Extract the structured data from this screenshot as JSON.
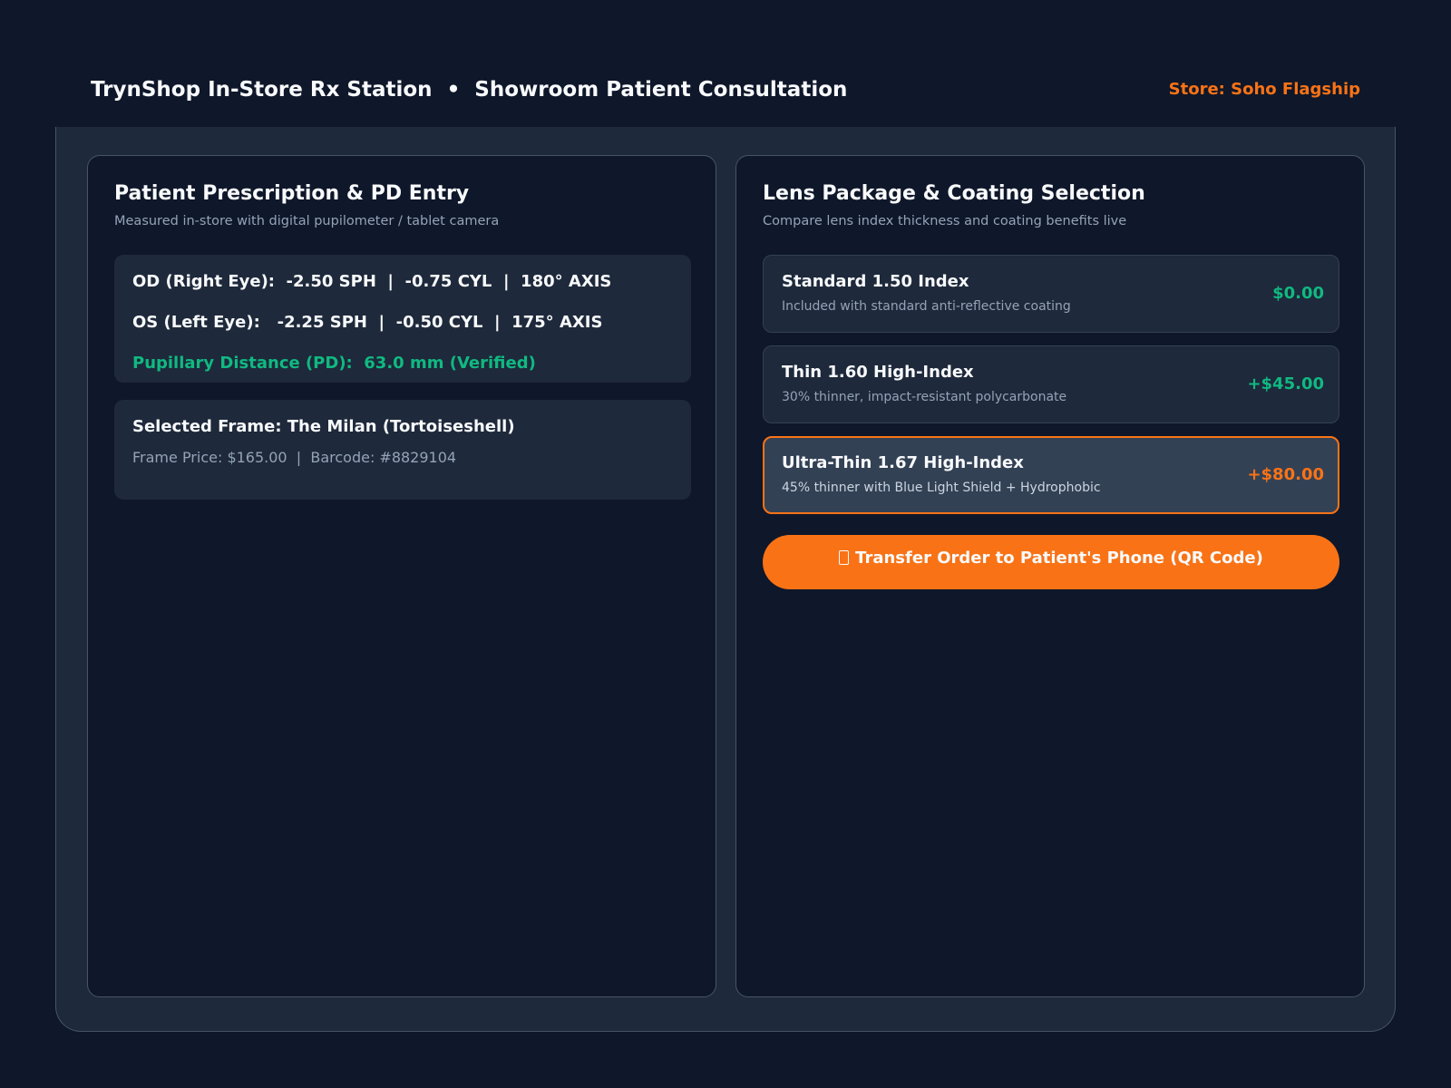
{
  "header": {
    "title": "TrynShop In-Store Rx Station  •  Showroom Patient Consultation",
    "store": "Store: Soho Flagship"
  },
  "prescription_panel": {
    "title": "Patient Prescription & PD Entry",
    "subtitle": "Measured in-store with digital pupilometer / tablet camera",
    "rx": {
      "od": "OD (Right Eye):  -2.50 SPH  |  -0.75 CYL  |  180° AXIS",
      "os": "OS (Left Eye):   -2.25 SPH  |  -0.50 CYL  |  175° AXIS",
      "pd": "Pupillary Distance (PD):  63.0 mm (Verified)"
    },
    "frame": {
      "name": "Selected Frame: The Milan (Tortoiseshell)",
      "meta": "Frame Price: $165.00  |  Barcode: #8829104"
    }
  },
  "lens_panel": {
    "title": "Lens Package & Coating Selection",
    "subtitle": "Compare lens index thickness and coating benefits live",
    "options": [
      {
        "name": "Standard 1.50 Index",
        "description": "Included with standard anti-reflective coating",
        "price": "$0.00",
        "selected": false
      },
      {
        "name": "Thin 1.60 High-Index",
        "description": "30% thinner, impact-resistant polycarbonate",
        "price": "+$45.00",
        "selected": false
      },
      {
        "name": "Ultra-Thin 1.67 High-Index",
        "description": "45% thinner with Blue Light Shield + Hydrophobic",
        "price": "+$80.00",
        "selected": true
      }
    ],
    "transfer_button": {
      "label": "Transfer Order to Patient's Phone (QR Code)",
      "icon": "mobile-phone-icon"
    }
  },
  "colors": {
    "background": "#0f172a",
    "surface": "#1e293b",
    "accent": "#f97316",
    "success": "#10b981",
    "text": "#f8fafc",
    "muted": "#94a3b8"
  }
}
